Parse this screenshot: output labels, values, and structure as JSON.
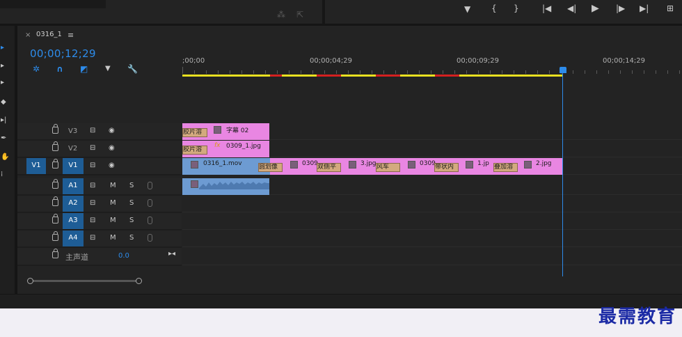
{
  "sequence": {
    "tab_title": "0316_1",
    "close_glyph": "×",
    "menu_glyph": "≡",
    "timecode": "00;00;12;29"
  },
  "ruler": {
    "labels": [
      ";00;00",
      "00;00;04;29",
      "00;00;09;29",
      "00;00;14;29"
    ]
  },
  "tracks": {
    "video": [
      {
        "name": "V3",
        "source": "",
        "selected": false
      },
      {
        "name": "V2",
        "source": "",
        "selected": false
      },
      {
        "name": "V1",
        "source": "V1",
        "selected": true
      }
    ],
    "audio": [
      {
        "name": "A1",
        "mute": "M",
        "solo": "S"
      },
      {
        "name": "A2",
        "mute": "M",
        "solo": "S"
      },
      {
        "name": "A3",
        "mute": "M",
        "solo": "S"
      },
      {
        "name": "A4",
        "mute": "M",
        "solo": "S"
      }
    ],
    "master": {
      "name": "主声道",
      "value": "0.0"
    }
  },
  "clips": {
    "v3_label": "字幕 02",
    "v3_transition": "胶片溶",
    "v2_label": "0309_1.jpg",
    "v2_transition": "胶片溶",
    "v1_items": [
      {
        "label": "0316_1.mov"
      },
      {
        "trans": "圆划像"
      },
      {
        "label": "0309"
      },
      {
        "trans": "双侧平"
      },
      {
        "label": "3.jpg"
      },
      {
        "trans": "风车"
      },
      {
        "label": "0309"
      },
      {
        "trans": "带状内"
      },
      {
        "label": "1.jp"
      },
      {
        "trans": "叠加溶"
      },
      {
        "label": "2.jpg"
      }
    ]
  },
  "watermark": "最需教育",
  "colors": {
    "accent": "#2d8ceb",
    "clip_pink": "#e986e2",
    "clip_audio": "#6d9bd2",
    "transition": "#d3aa7e",
    "work_area_yellow": "#e8e020",
    "render_red": "#d42020"
  }
}
